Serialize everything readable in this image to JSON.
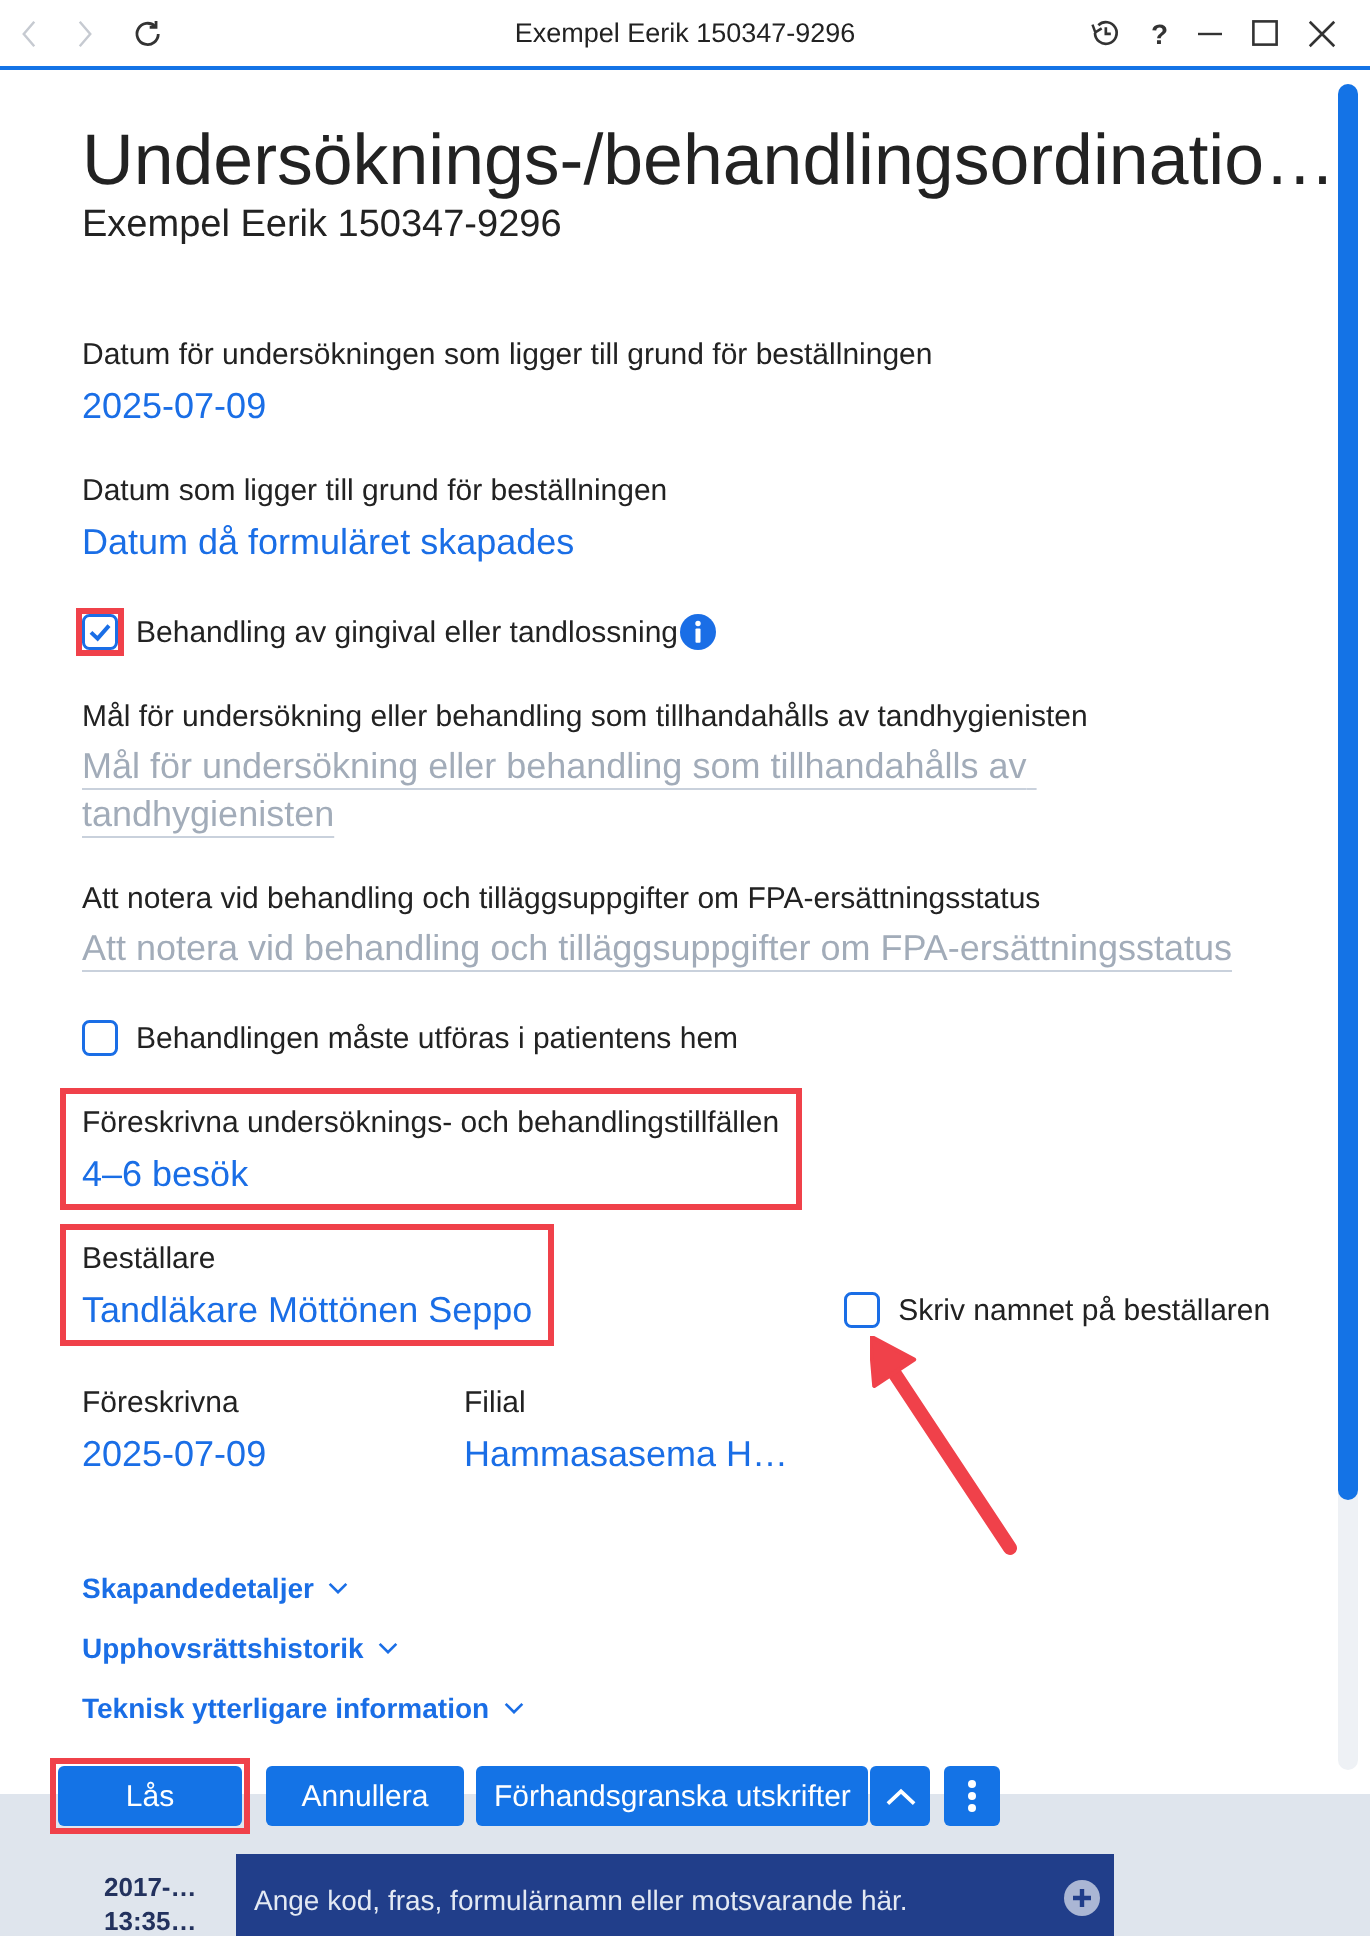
{
  "window": {
    "title": "Exempel Eerik 150347-9296",
    "left_buttons": [
      {
        "kind": "back",
        "disabled": true
      },
      {
        "kind": "forward",
        "disabled": true
      },
      {
        "kind": "reload",
        "disabled": false
      }
    ],
    "right_buttons": [
      {
        "kind": "history"
      },
      {
        "kind": "help",
        "label": "?"
      },
      {
        "kind": "minimize"
      },
      {
        "kind": "maximize"
      },
      {
        "kind": "close"
      }
    ]
  },
  "header": {
    "title": "Undersöknings-/behandlingsordinatio…",
    "subtitle": "Exempel Eerik 150347-9296"
  },
  "form": {
    "items": [
      {
        "kind": "value",
        "label": "Datum för undersökningen som ligger till grund för beställningen",
        "value": "2025-07-09",
        "highlighted": false
      },
      {
        "kind": "value",
        "label": "Datum som ligger till grund för beställningen",
        "value": "Datum då formuläret skapades",
        "highlighted": false
      },
      {
        "kind": "checkbox",
        "label": "Behandling av gingival eller tandlossning",
        "checked": true,
        "highlighted": true,
        "info": true
      },
      {
        "kind": "text",
        "label": "Mål för undersökning eller behandling som tillhandahålls av tandhygienisten",
        "placeholder": "Mål för undersökning eller behandling som tillhandahålls av tandhygienisten"
      },
      {
        "kind": "text",
        "label": "Att notera vid behandling och tilläggsuppgifter om FPA-ersättningsstatus",
        "placeholder": "Att notera vid behandling och tilläggsuppgifter om FPA-ersättningsstatus"
      },
      {
        "kind": "checkbox",
        "label": "Behandlingen måste utföras i patientens hem",
        "checked": false,
        "highlighted": false,
        "info": false
      },
      {
        "kind": "value",
        "label": "Föreskrivna undersöknings- och behandlingstillfällen",
        "value": "4–6 besök",
        "highlighted": true
      },
      {
        "kind": "value",
        "label": "Beställare",
        "value": "Tandläkare Möttönen Seppo",
        "highlighted": true,
        "checkbox": {
          "label": "Skriv namnet på beställaren",
          "checked": false,
          "pointed_at": true
        }
      },
      {
        "kind": "columns",
        "columns": [
          {
            "label": "Föreskrivna",
            "value": "2025-07-09"
          },
          {
            "label": "Filial",
            "value": "Hammasasema H…"
          }
        ]
      }
    ]
  },
  "sections": [
    {
      "label": "Skapandedetaljer",
      "expanded": false
    },
    {
      "label": "Upphovsrättshistorik",
      "expanded": false
    },
    {
      "label": "Teknisk ytterligare information",
      "expanded": false
    }
  ],
  "actions": [
    {
      "kind": "text",
      "label": "Lås",
      "highlighted": true
    },
    {
      "kind": "text",
      "label": "Annullera",
      "highlighted": false
    },
    {
      "kind": "text",
      "label": "Förhandsgranska utskrifter",
      "highlighted": false
    },
    {
      "kind": "expand",
      "highlighted": false
    },
    {
      "kind": "more",
      "highlighted": false
    }
  ],
  "journal": {
    "date": "2017-…",
    "time": "13:35…",
    "entry_field": {
      "placeholder": "Ange kod, fras, formulärnamn eller motsvarande här."
    }
  }
}
